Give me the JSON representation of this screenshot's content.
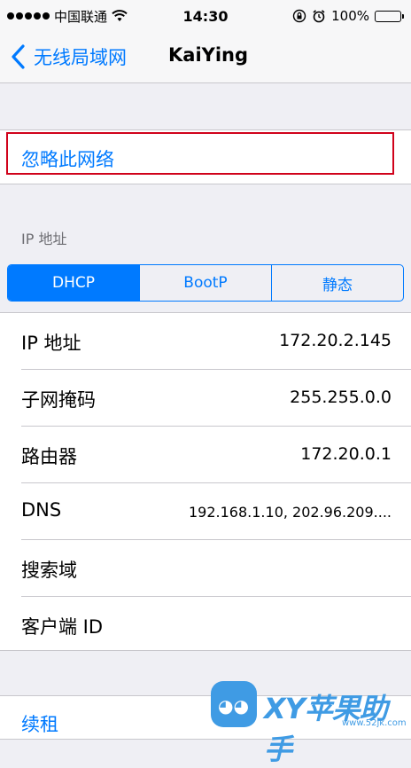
{
  "status_bar": {
    "carrier": "中国联通",
    "time": "14:30",
    "battery": "100%"
  },
  "nav": {
    "back_label": "无线局域网",
    "title": "KaiYing"
  },
  "forget_network": "忽略此网络",
  "ip_section": {
    "header": "IP 地址",
    "tabs": [
      {
        "label": "DHCP",
        "active": true
      },
      {
        "label": "BootP",
        "active": false
      },
      {
        "label": "静态",
        "active": false
      }
    ],
    "rows": [
      {
        "label": "IP 地址",
        "value": "172.20.2.145"
      },
      {
        "label": "子网掩码",
        "value": "255.255.0.0"
      },
      {
        "label": "路由器",
        "value": "172.20.0.1"
      },
      {
        "label": "DNS",
        "value": "192.168.1.10, 202.96.209...."
      },
      {
        "label": "搜索域",
        "value": ""
      },
      {
        "label": "客户端 ID",
        "value": ""
      }
    ]
  },
  "renew_lease": "续租",
  "watermark": {
    "brand": "XY苹果助手",
    "url": "www.52jk.com"
  },
  "colors": {
    "accent": "#007aff",
    "highlight": "#d0021b",
    "battery": "#4cd964"
  }
}
